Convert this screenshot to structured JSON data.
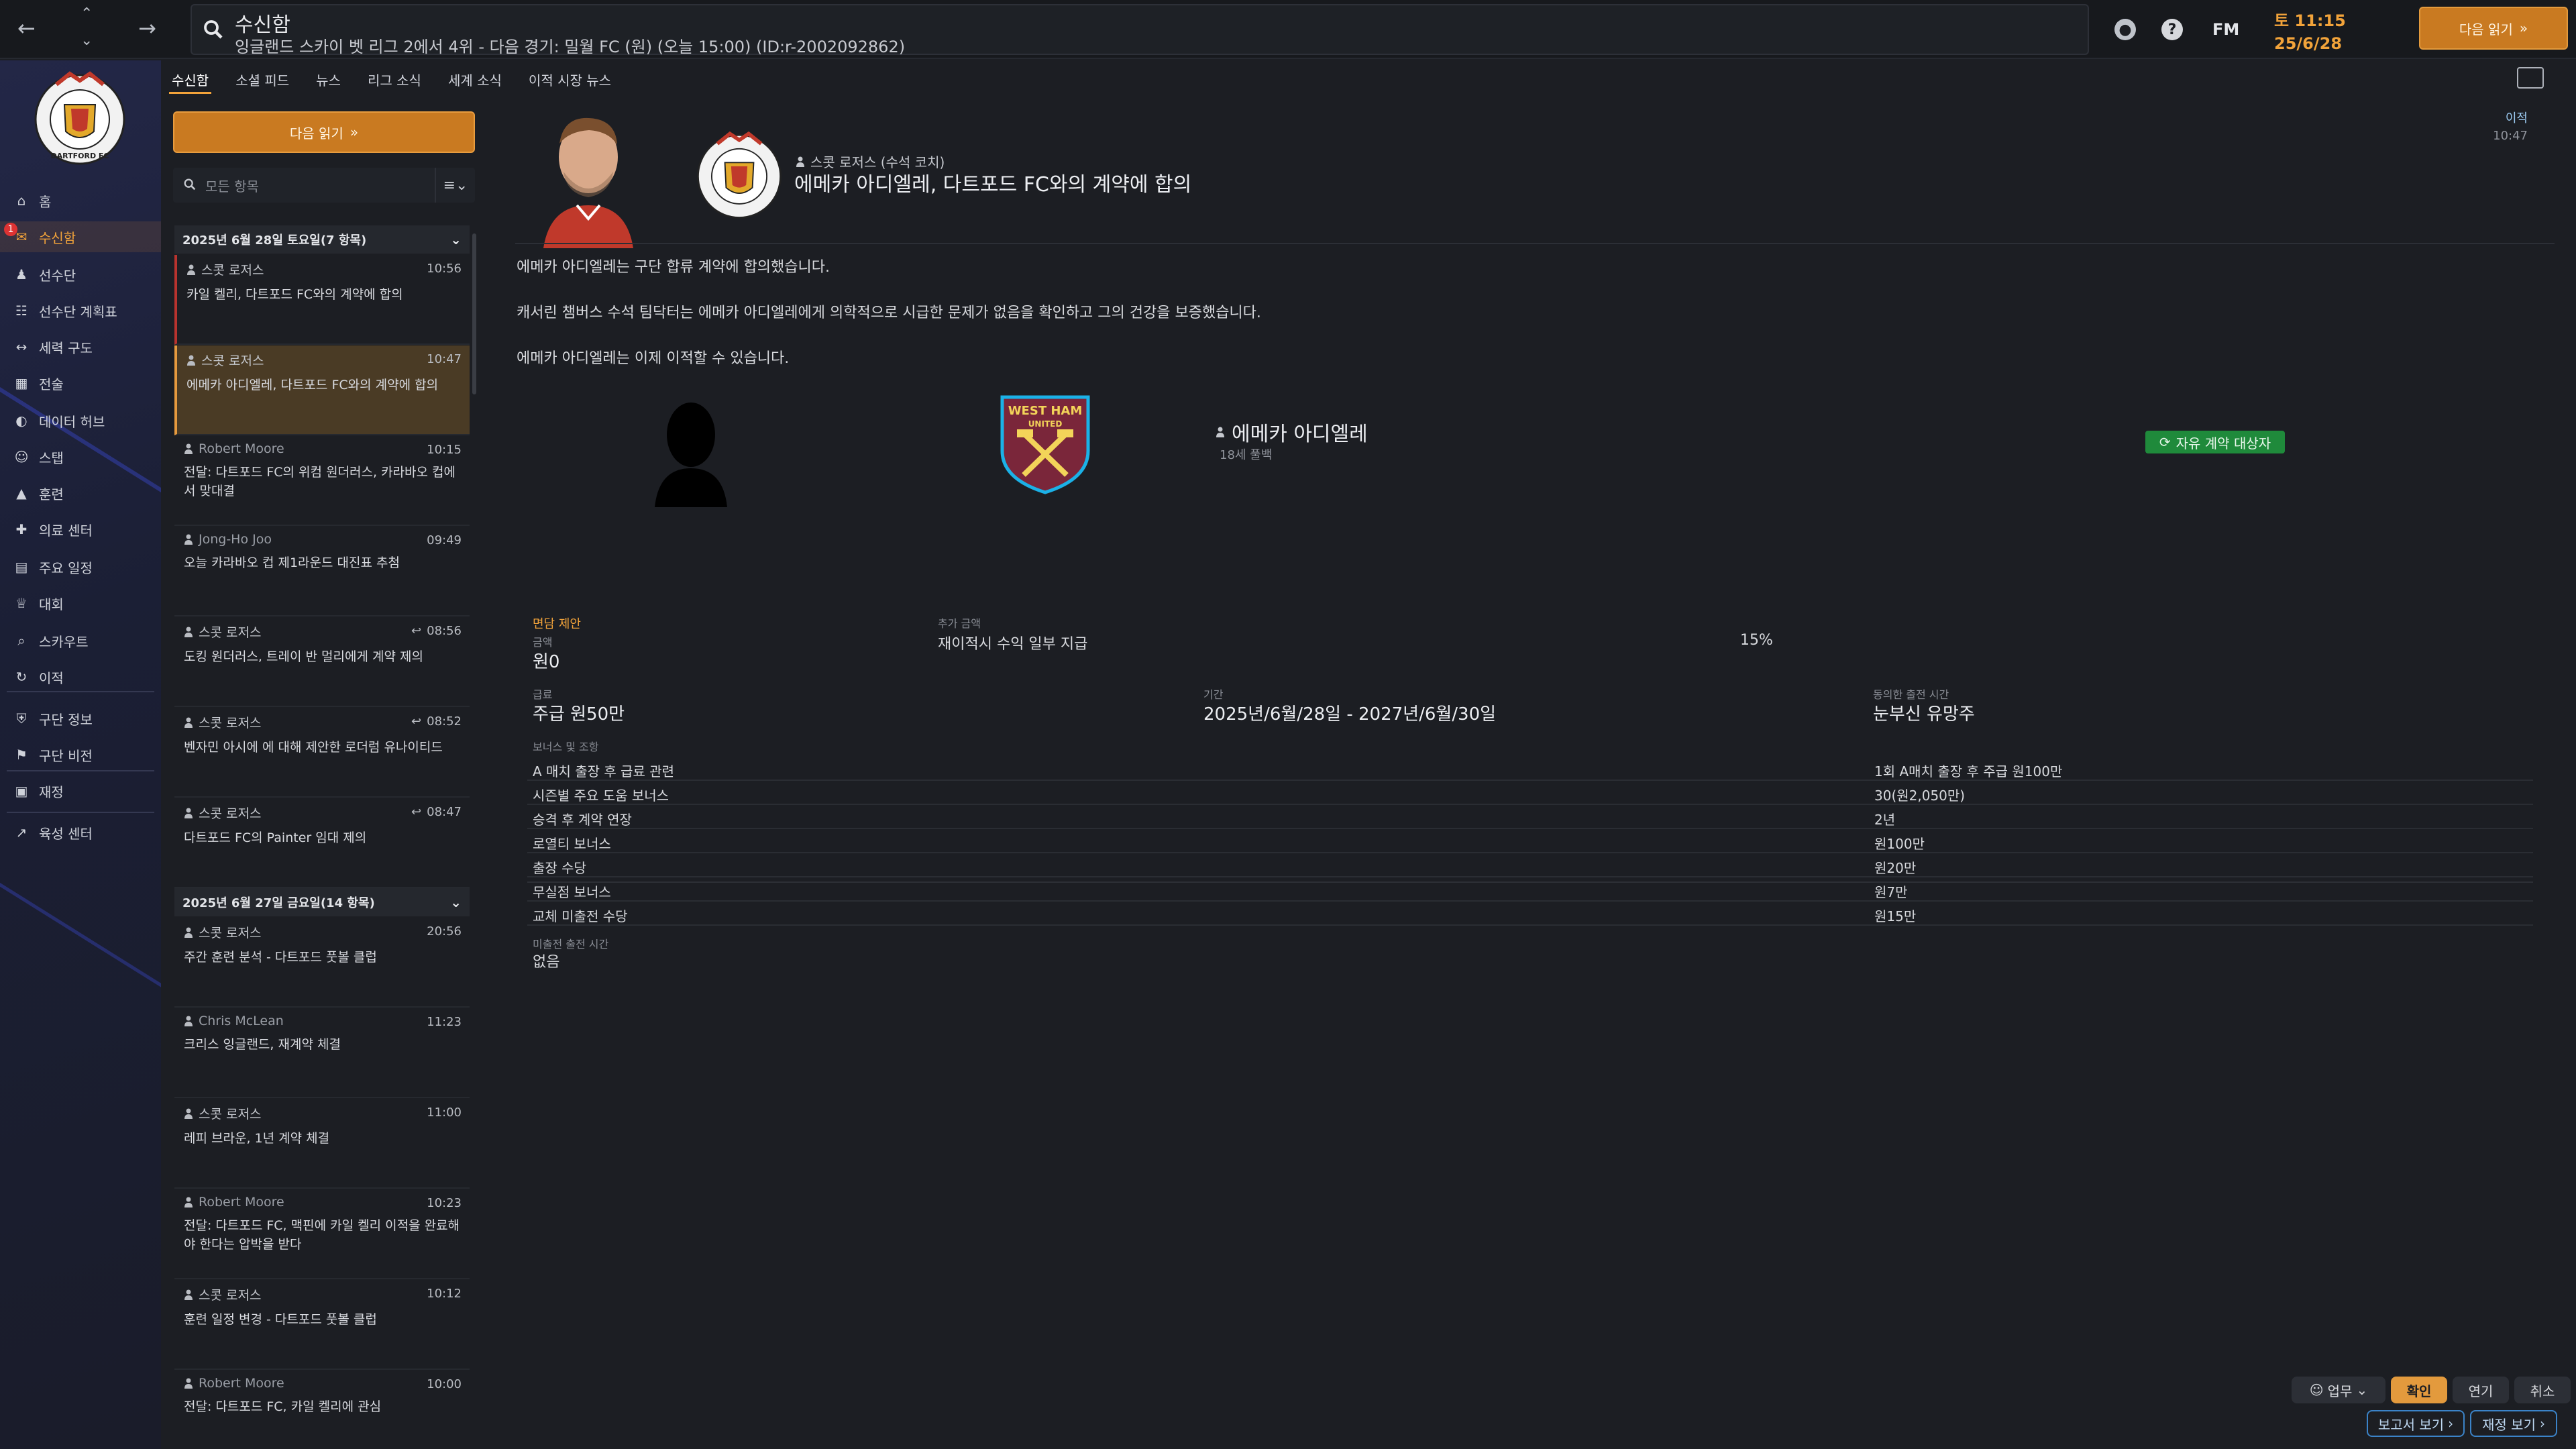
{
  "topbar": {
    "title": "수신함",
    "subtitle": "잉글랜드 스카이 벳 리그 2에서 4위 - 다음 경기: 밀월 FC (원) (오늘 15:00) (ID:r-2002092862)",
    "fm_logo": "FM",
    "date_time": "토 11:15",
    "date": "25/6/28",
    "continue_label": "다음 읽기"
  },
  "sidebar": {
    "items": [
      {
        "label": "홈",
        "icon": "home-icon"
      },
      {
        "label": "수신함",
        "icon": "inbox-icon",
        "active": true,
        "badge": "1"
      },
      {
        "label": "선수단",
        "icon": "squad-icon"
      },
      {
        "label": "선수단 계획표",
        "icon": "clipboard-icon"
      },
      {
        "label": "세력 구도",
        "icon": "dynamics-icon"
      },
      {
        "label": "전술",
        "icon": "tactics-icon"
      },
      {
        "label": "데이터 허브",
        "icon": "data-hub-icon"
      },
      {
        "label": "스탭",
        "icon": "staff-icon"
      },
      {
        "label": "훈련",
        "icon": "training-icon"
      },
      {
        "label": "의료 센터",
        "icon": "medical-icon"
      },
      {
        "label": "주요 일정",
        "icon": "calendar-icon"
      },
      {
        "label": "대회",
        "icon": "trophy-icon"
      },
      {
        "label": "스카우트",
        "icon": "scouting-icon"
      },
      {
        "label": "이적",
        "icon": "transfer-icon"
      },
      {
        "label": "구단 정보",
        "icon": "club-info-icon"
      },
      {
        "label": "구단 비전",
        "icon": "club-vision-icon"
      },
      {
        "label": "재정",
        "icon": "finances-icon"
      },
      {
        "label": "육성 센터",
        "icon": "dev-centre-icon"
      }
    ]
  },
  "subtabs": [
    "수신함",
    "소셜 피드",
    "뉴스",
    "리그 소식",
    "세계 소식",
    "이적 시장 뉴스"
  ],
  "inbox": {
    "continue_label": "다음 읽기",
    "filter_placeholder": "모든 항목",
    "groups": [
      {
        "header": "2025년 6월 28일 토요일(7 항목)",
        "messages": [
          {
            "sender": "스콧 로저스",
            "time": "10:56",
            "subject": "카일 켈리, 다트포드 FC와의 계약에 합의",
            "state": "unread"
          },
          {
            "sender": "스콧 로저스",
            "time": "10:47",
            "subject": "에메카 아디엘레, 다트포드 FC와의 계약에 합의",
            "state": "active"
          },
          {
            "sender": "Robert Moore",
            "time": "10:15",
            "subject": "전달: 다트포드 FC의 위컴 원더러스, 카라바오 컵에서 맞대결",
            "state": ""
          },
          {
            "sender": "Jong-Ho Joo",
            "time": "09:49",
            "subject": "오늘 카라바오 컵 제1라운드 대진표 추첨",
            "state": ""
          },
          {
            "sender": "스콧 로저스",
            "time": "08:56",
            "subject": "도킹 원더러스, 트레이 반 멀리에게 계약 제의",
            "state": "",
            "replied": true
          },
          {
            "sender": "스콧 로저스",
            "time": "08:52",
            "subject": "벤자민 아시에 에 대해 제안한 로더럼 유나이티드",
            "state": "",
            "replied": true
          },
          {
            "sender": "스콧 로저스",
            "time": "08:47",
            "subject": "다트포드 FC의 Painter 임대 제의",
            "state": "",
            "replied": true
          }
        ]
      },
      {
        "header": "2025년 6월 27일 금요일(14 항목)",
        "messages": [
          {
            "sender": "스콧 로저스",
            "time": "20:56",
            "subject": "주간 훈련 분석 - 다트포드 풋볼 클럽",
            "state": ""
          },
          {
            "sender": "Chris McLean",
            "time": "11:23",
            "subject": "크리스 잉글랜드, 재계약 체결",
            "state": ""
          },
          {
            "sender": "스콧 로저스",
            "time": "11:00",
            "subject": "레피 브라운, 1년 계약 체결",
            "state": ""
          },
          {
            "sender": "Robert Moore",
            "time": "10:23",
            "subject": "전달: 다트포드 FC, 맥핀에 카일 켈리 이적을 완료해야 한다는 압박을 받다",
            "state": ""
          },
          {
            "sender": "스콧 로저스",
            "time": "10:12",
            "subject": "훈련 일정 변경 - 다트포드 풋볼 클럽",
            "state": ""
          },
          {
            "sender": "Robert Moore",
            "time": "10:00",
            "subject": "전달: 다트포드 FC, 카일 켈리에 관심",
            "state": ""
          }
        ]
      }
    ]
  },
  "message": {
    "sender": "스콧 로저스 (수석 코치)",
    "title": "에메카 아디엘레, 다트포드 FC와의 계약에 합의",
    "tag": "이적",
    "tag_time": "10:47",
    "paragraphs": [
      "에메카 아디엘레는 구단 합류 계약에 합의했습니다.",
      "캐서린 챔버스 수석 팀닥터는 에메카 아디엘레에게 의학적으로 시급한 문제가 없음을 확인하고 그의 건강을 보증했습니다.",
      "에메카 아디엘레는 이제 이적할 수 있습니다."
    ]
  },
  "contract": {
    "player_name": "에메카 아디엘레",
    "player_sub": "18세 풀백",
    "status_badge": "자유 계약 대상자",
    "offer_label": "면담 제안",
    "fee_label": "금액",
    "fee_value": "원0",
    "extra_label": "추가 금액",
    "extra_value": "재이적시 수익 일부 지급",
    "extra_percent": "15%",
    "wage_label": "급료",
    "wage_value": "주급 원50만",
    "period_label": "기간",
    "period_value": "2025년/6월/28일 - 2027년/6월/30일",
    "playing_time_label": "동의한 출전 시간",
    "playing_time_value": "눈부신 유망주",
    "bonus_label": "보너스 및 조항",
    "bonuses": [
      {
        "k": "A 매치 출장 후 급료 관련",
        "v": "1회 A매치 출장 후 주급 원100만"
      },
      {
        "k": "시즌별 주요 도움 보너스",
        "v": "30(원2,050만)"
      },
      {
        "k": "승격 후 계약 연장",
        "v": "2년"
      },
      {
        "k": "로열티 보너스",
        "v": "원100만"
      },
      {
        "k": "출장 수당",
        "v": "원20만"
      },
      {
        "k": "무실점 보너스",
        "v": "원7만"
      },
      {
        "k": "교체 미출전 수당",
        "v": "원15만"
      }
    ],
    "min_time_label": "미출전 출전 시간",
    "min_time_value": "없음"
  },
  "actions": {
    "role": "업무",
    "confirm": "확인",
    "delay": "연기",
    "cancel": "취소",
    "report": "보고서 보기",
    "finance": "재정 보기"
  },
  "colors": {
    "accent": "#e39a3d",
    "background": "#1c1e23",
    "sidebar": "#232747",
    "badge_green": "#1f8a3b",
    "unread": "#b8332e"
  }
}
